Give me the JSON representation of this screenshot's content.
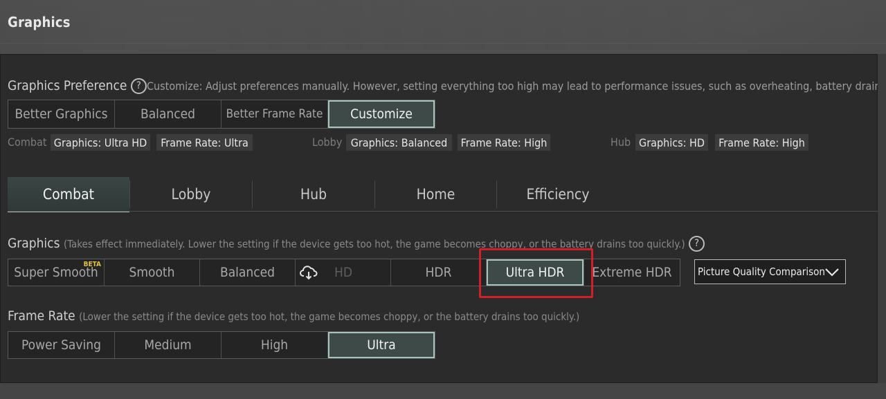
{
  "title": "Graphics",
  "preference": {
    "label": "Graphics Preference",
    "help_icon": "question-icon",
    "description": "Customize: Adjust preferences manually. However, setting everything too high may lead to performance issues, such as overheating, battery drain, c",
    "options": [
      "Better Graphics",
      "Balanced",
      "Better Frame Rate",
      "Customize"
    ],
    "selected": "Customize"
  },
  "summary": {
    "combat": {
      "label": "Combat",
      "graphics": "Graphics: Ultra HD",
      "frame_rate": "Frame Rate: Ultra"
    },
    "lobby": {
      "label": "Lobby",
      "graphics": "Graphics: Balanced",
      "frame_rate": "Frame Rate: High"
    },
    "hub": {
      "label": "Hub",
      "graphics": "Graphics: HD",
      "frame_rate": "Frame Rate: High"
    }
  },
  "tabs": [
    "Combat",
    "Lobby",
    "Hub",
    "Home",
    "Efficiency"
  ],
  "selected_tab": "Combat",
  "graphics": {
    "label": "Graphics",
    "hint": "(Takes effect immediately. Lower the setting if the device gets too hot, the game becomes choppy, or the battery drains too quickly.)",
    "options": [
      "Super Smooth",
      "Smooth",
      "Balanced",
      "HD",
      "HDR",
      "Ultra HDR",
      "Extreme HDR"
    ],
    "beta_badge": "BETA",
    "download_icon": "cloud-download-icon",
    "selected": "Ultra HDR",
    "comparison_label": "Picture Quality Comparison"
  },
  "frame_rate": {
    "label": "Frame Rate",
    "hint": "(Lower the setting if the device gets too hot, the game becomes choppy, or the battery drains too quickly.)",
    "options": [
      "Power Saving",
      "Medium",
      "High",
      "Ultra"
    ],
    "selected": "Ultra"
  },
  "colors": {
    "selected_border": "#a9c4bd",
    "highlight": "#d0202a",
    "beta": "#e0c24a"
  }
}
